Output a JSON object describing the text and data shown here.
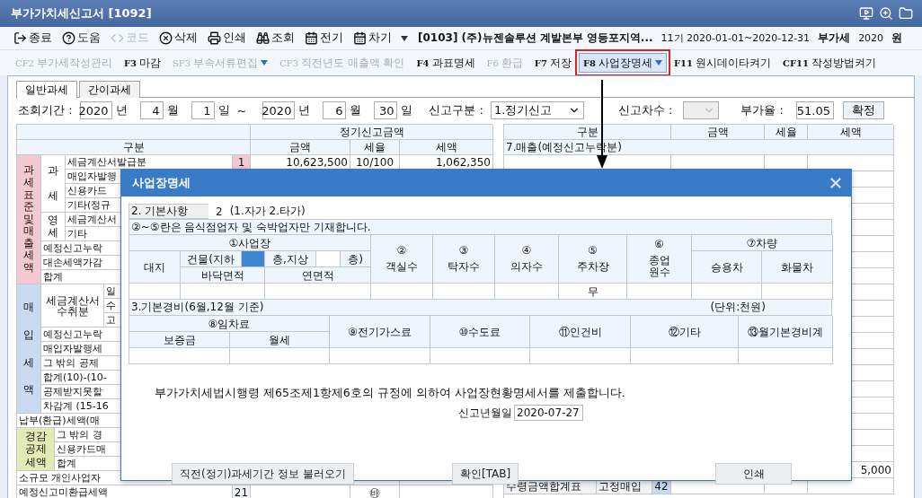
{
  "window": {
    "title": "부가가치세신고서 [1092]"
  },
  "toolbar": [
    {
      "kind": "exit",
      "label": "종료",
      "disabled": false
    },
    {
      "kind": "help",
      "label": "도움",
      "disabled": false
    },
    {
      "kind": "code",
      "label": "코드",
      "disabled": true
    },
    {
      "kind": "delete",
      "label": "삭제",
      "disabled": false
    },
    {
      "kind": "print",
      "label": "인쇄",
      "disabled": false
    },
    {
      "kind": "search",
      "label": "조회",
      "disabled": false
    },
    {
      "kind": "prev",
      "label": "전기",
      "disabled": false
    },
    {
      "kind": "next",
      "label": "차기",
      "disabled": false
    }
  ],
  "company": {
    "name": "[0103] (주)뉴젠솔루션 계발본부 영등포지역...",
    "period": "11기 2020-01-01~2020-12-31",
    "tax_type": "부가세",
    "year": "2020",
    "cut": "원"
  },
  "function_keys": [
    {
      "key": "CF2",
      "label": "부가세작성관리",
      "disabled": true,
      "selected": false,
      "dropdown": false
    },
    {
      "key": "F3",
      "label": "마감",
      "disabled": false,
      "selected": false,
      "dropdown": false
    },
    {
      "key": "SF3",
      "label": "부속서류편집",
      "disabled": true,
      "selected": false,
      "dropdown": true
    },
    {
      "key": "CF3",
      "label": "직전년도 매출액 확인",
      "disabled": true,
      "selected": false,
      "dropdown": false
    },
    {
      "key": "F4",
      "label": "과표명세",
      "disabled": false,
      "selected": false,
      "dropdown": false
    },
    {
      "key": "F6",
      "label": "환급",
      "disabled": true,
      "selected": false,
      "dropdown": false
    },
    {
      "key": "F7",
      "label": "저장",
      "disabled": false,
      "selected": false,
      "dropdown": false
    },
    {
      "key": "F8",
      "label": "사업장명세",
      "disabled": false,
      "selected": true,
      "dropdown": true
    },
    {
      "key": "F11",
      "label": "원시데이타켜기",
      "disabled": false,
      "selected": false,
      "dropdown": false
    },
    {
      "key": "CF11",
      "label": "작성방법켜기",
      "disabled": false,
      "selected": false,
      "dropdown": false
    }
  ],
  "tabs": [
    {
      "label": "일반과세",
      "selected": true
    },
    {
      "label": "간이과세",
      "selected": false
    }
  ],
  "query": {
    "period_label": "조회기간 :",
    "dates": [
      {
        "year": "2020",
        "year_unit": "년",
        "month": "4",
        "month_unit": "월",
        "day": "1",
        "day_unit": "일"
      },
      {
        "year": "2020",
        "year_unit": "년",
        "month": "6",
        "month_unit": "월",
        "day": "30",
        "day_unit": "일"
      }
    ],
    "range_sep": "~",
    "report_type": {
      "label": "신고구분 :",
      "value": "1.정기신고"
    },
    "report_seq": {
      "label": "신고차수 :",
      "disabled": true
    },
    "ratio": {
      "label": "부가율 :",
      "value": "51.05"
    },
    "confirm_button": "확정"
  },
  "left_table": {
    "header_top": "정기신고금액",
    "columns": [
      "구분",
      "금액",
      "세율",
      "세액"
    ],
    "sections": [
      {
        "kind": "tax_base",
        "title": "과세표준및매출세액",
        "color": "#f2c9d0",
        "groups": [
          {
            "title": "과세",
            "rows": [
              {
                "label": "세금계산서발급분",
                "no": "1",
                "amount": "10,623,500",
                "rate": "10/100",
                "tax": "1,062,350"
              },
              {
                "label": "매입자발행"
              },
              {
                "label": "신용카드"
              },
              {
                "label": "기타(정규"
              }
            ]
          },
          {
            "title": "영세",
            "rows": [
              {
                "label": "세금계산서"
              },
              {
                "label": "기타"
              }
            ]
          }
        ],
        "rows": [
          {
            "label": "예정신고누락"
          },
          {
            "label": "대손세액가감"
          },
          {
            "label": "합계"
          }
        ]
      },
      {
        "kind": "input_tax",
        "title": "매입세액",
        "color": "#c9daf2",
        "groups": [
          {
            "title": "세금계산서 수취분",
            "rows": [
              {
                "label": "일"
              },
              {
                "label": "수"
              },
              {
                "label": "고"
              }
            ]
          }
        ],
        "rows": [
          {
            "label": "예정신고누락"
          },
          {
            "label": "매입자발행세"
          },
          {
            "label": "그 밖의 공제"
          },
          {
            "label": "합계(10)-(10-"
          },
          {
            "label": "공제받지못할"
          },
          {
            "label": "차감계 (15-16"
          }
        ]
      },
      {
        "kind": "full",
        "rows": [
          {
            "label": "납부(환급)세액(매"
          }
        ]
      },
      {
        "kind": "deduction",
        "title": "경감공제세액",
        "color": "#e3eab4",
        "rows": [
          {
            "label": "그 밖의 경"
          },
          {
            "label": "신용카드매"
          },
          {
            "label": "합계"
          }
        ]
      },
      {
        "kind": "full",
        "rows": [
          {
            "label": "소규모 개인사업자"
          },
          {
            "label": "예정신고미환급세액",
            "no": "21",
            "rate": "㉳"
          }
        ]
      }
    ]
  },
  "right_table": {
    "columns": [
      "구분",
      "금액",
      "세율",
      "세액"
    ],
    "section_title": "7.매출(예정신고누락분)",
    "rows": [
      {
        "tax": "5,000"
      },
      {
        "label": "수령금액합계표",
        "sub": "고정매입",
        "no": "42"
      }
    ]
  },
  "dialog": {
    "title": "사업장명세",
    "basic": {
      "label": "2. 기본사항",
      "value": "2",
      "hint": "(1.자가 2.타가)"
    },
    "note": "②~⑤란은 음식점업자 및 숙박업자만 기재합니다.",
    "site": {
      "title": "①사업장",
      "land": "대지",
      "building": "건물(지하",
      "floor_mid": "층,지상",
      "floor_end": "층)",
      "floor_area": "바닥면적",
      "total_area": "연면적",
      "basement_focused": true
    },
    "facilities": [
      {
        "mark": "②",
        "label": "객실수"
      },
      {
        "mark": "③",
        "label": "탁자수"
      },
      {
        "mark": "④",
        "label": "의자수"
      },
      {
        "mark": "⑤",
        "label": "주차장",
        "value": "무"
      },
      {
        "mark": "⑥",
        "label": "종업\n원수"
      }
    ],
    "vehicle": {
      "title": "⑦차량",
      "columns": [
        "승용차",
        "화물차"
      ]
    },
    "expense_title": "3.기본경비(6월,12월 기준)",
    "unit": "(단위:천원)",
    "rent": {
      "title": "⑧임차료",
      "columns": [
        "보증금",
        "월세"
      ]
    },
    "expense_columns": [
      "⑨전기가스료",
      "⑩수도료",
      "⑪인건비",
      "⑫기타",
      "⑬월기본경비계"
    ],
    "statement": "부가가치세법시행령 제65조제1항제6호의 규정에 의하여 사업장현황명세서를 제출합니다.",
    "date_label": "신고년월일",
    "date_value": "2020-07-27",
    "buttons": [
      "직전(정기)과세기간 정보 불러오기",
      "확인[TAB]",
      "인쇄"
    ]
  }
}
